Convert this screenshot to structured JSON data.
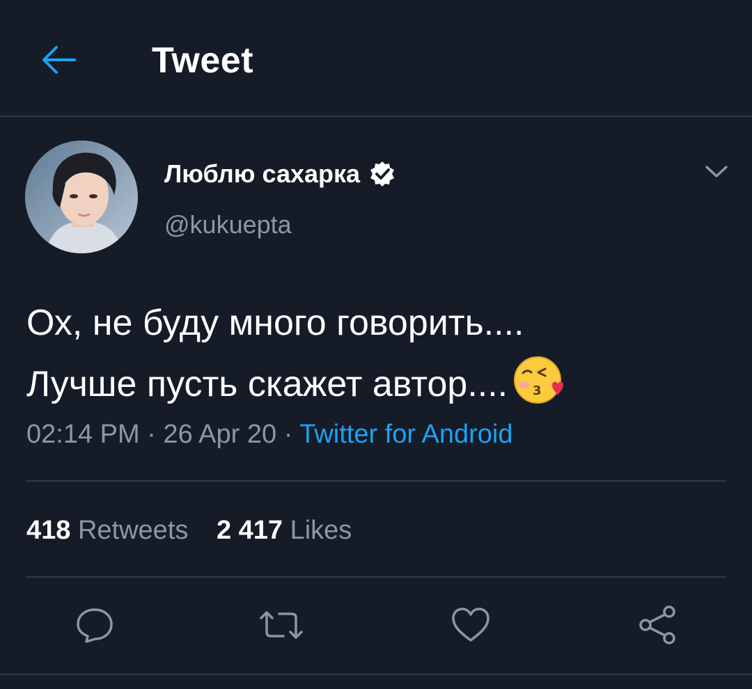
{
  "header": {
    "title": "Tweet",
    "back_icon": "arrow-left-icon"
  },
  "tweet": {
    "author": {
      "display_name": "Люблю сахарка",
      "handle": "@kukuepta",
      "verified": true
    },
    "text_lines": [
      "Ох, не буду много говорить....",
      "Лучше пусть скажет автор...."
    ],
    "emoji": "kissing-face-with-heart-emoji",
    "time": "02:14 PM",
    "date": "26 Apr 20",
    "separator": "·",
    "source": "Twitter for Android",
    "stats": {
      "retweets_count": "418",
      "retweets_label": "Retweets",
      "likes_count": "2 417",
      "likes_label": "Likes"
    }
  },
  "actions": [
    "reply-icon",
    "retweet-icon",
    "like-icon",
    "share-icon"
  ],
  "colors": {
    "background": "#151c28",
    "accent": "#1da1f2",
    "secondary_text": "#8899a6",
    "divider": "#2e3a49"
  }
}
